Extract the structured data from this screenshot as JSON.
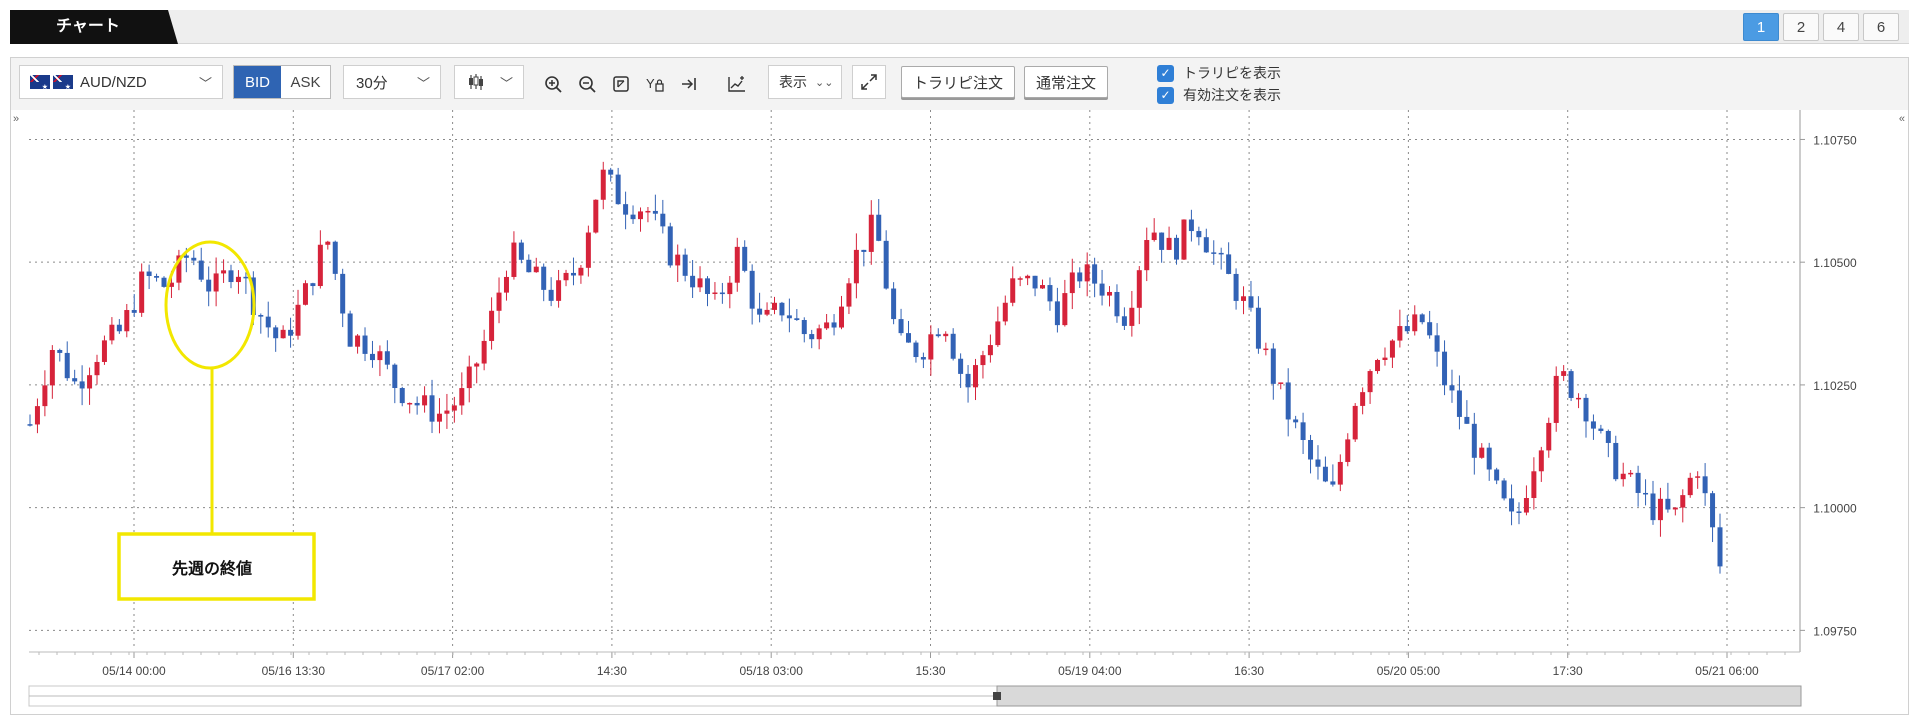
{
  "tabbar": {
    "title": "チャート",
    "pages": [
      "1",
      "2",
      "4",
      "6"
    ],
    "active_page": "1"
  },
  "toolbar": {
    "pair_label": "AUD/NZD",
    "bid_label": "BID",
    "ask_label": "ASK",
    "timeframe": "30分",
    "display_label": "表示",
    "trap_order_label": "トラリピ注文",
    "normal_order_label": "通常注文",
    "checkbox_show_trap": "トラリピを表示",
    "checkbox_show_orders": "有効注文を表示",
    "icons": [
      "candlestick-icon",
      "zoom-in-icon",
      "zoom-out-icon",
      "fit-icon",
      "y-lock-icon",
      "scroll-end-icon",
      "indicator-add-icon",
      "expand-icon"
    ]
  },
  "colors": {
    "up": "#d6233a",
    "down": "#3262b5",
    "grid": "#8a8a8a",
    "annotation": "#f2e700",
    "bid_active": "#2f64b3",
    "page_active": "#4b9be3"
  },
  "annotation": {
    "text": "先週の終値"
  },
  "chart_data": {
    "type": "candlestick",
    "symbol": "AUD/NZD",
    "side": "BID",
    "timeframe": "30分",
    "ylim": [
      1.0971,
      1.1081
    ],
    "y_ticks": [
      "1.10750",
      "1.10500",
      "1.10250",
      "1.10000",
      "1.09750"
    ],
    "y_tick_values": [
      1.1075,
      1.105,
      1.1025,
      1.1,
      1.0975
    ],
    "x_tick_labels": [
      "05/14 00:00",
      "05/16 13:30",
      "05/17 02:00",
      "14:30",
      "05/18 03:00",
      "15:30",
      "05/19 04:00",
      "16:30",
      "05/20 05:00",
      "17:30",
      "05/21 06:00"
    ],
    "close_path": [
      1.1017,
      1.1033,
      1.1025,
      1.1032,
      1.1036,
      1.1047,
      1.1045,
      1.1052,
      1.1044,
      1.105,
      1.104,
      1.1033,
      1.1043,
      1.1055,
      1.1035,
      1.1033,
      1.1025,
      1.1021,
      1.1019,
      1.1023,
      1.1035,
      1.1052,
      1.1047,
      1.1043,
      1.1049,
      1.1068,
      1.1062,
      1.1061,
      1.1052,
      1.1047,
      1.1041,
      1.1052,
      1.1037,
      1.1041,
      1.1035,
      1.1037,
      1.105,
      1.1058,
      1.1033,
      1.1032,
      1.1039,
      1.1024,
      1.1034,
      1.1045,
      1.1046,
      1.104,
      1.1048,
      1.1045,
      1.1039,
      1.1058,
      1.1052,
      1.1059,
      1.105,
      1.1043,
      1.1032,
      1.102,
      1.101,
      1.1002,
      1.1022,
      1.1032,
      1.1035,
      1.1038,
      1.1025,
      1.1015,
      1.1005,
      1.0996,
      1.1012,
      1.1027,
      1.1022,
      1.1011,
      1.1005,
      1.1,
      1.0998,
      1.1009,
      1.0988
    ]
  }
}
